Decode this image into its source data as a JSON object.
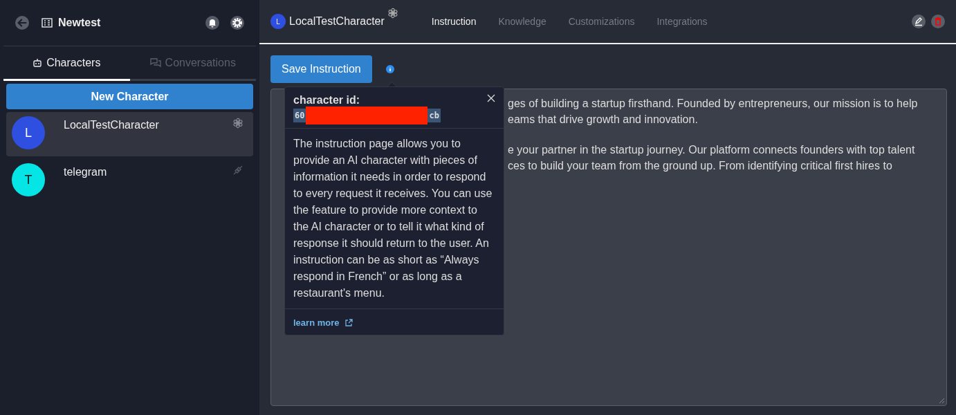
{
  "sidebar": {
    "workspace": "Newtest",
    "tabs": [
      {
        "label": "Characters",
        "kind": "robot",
        "selected": true
      },
      {
        "label": "Conversations",
        "kind": "chat",
        "selected": false
      }
    ],
    "new_button": "New Character",
    "items": [
      {
        "initial": "L",
        "name": "LocalTestCharacter",
        "color": "#2f4fe0",
        "kind": "flower",
        "selected": true
      },
      {
        "initial": "T",
        "name": "telegram",
        "color": "#06e5e5",
        "kind": "plug",
        "selected": false
      }
    ]
  },
  "header": {
    "avatar": "L",
    "name": "LocalTestCharacter",
    "tabs": [
      {
        "label": "Instruction",
        "selected": true
      },
      {
        "label": "Knowledge",
        "selected": false
      },
      {
        "label": "Customizations",
        "selected": false
      },
      {
        "label": "Integrations",
        "selected": false
      }
    ]
  },
  "save_button": "Save Instruction",
  "instruction_paragraphs": [
    [
      "ges of building a startup firsthand. Founded by entrepreneurs, our mission is to help",
      "eams that drive growth and innovation."
    ],
    [
      "e your partner in the startup journey. Our platform connects founders with top talent",
      "ces to build your team from the ground up. From identifying critical first hires to"
    ]
  ],
  "popover": {
    "title": "character id:",
    "id_start": "60",
    "id_end": "cb",
    "body": "The instruction page allows you to provide an AI character with pieces of information it needs in order to respond to every request it receives. You can use the feature to provide more context to the AI character or to tell it what kind of response it should return to the user. An instruction can be as short as “Always respond in French” or as long as a restaurant's menu.",
    "link": "learn more"
  }
}
